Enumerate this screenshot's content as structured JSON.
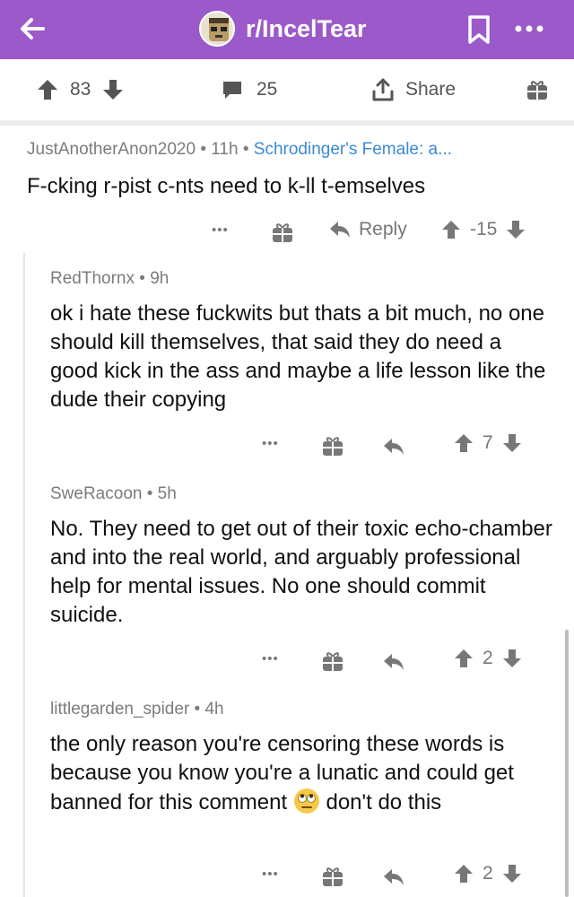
{
  "header": {
    "subreddit": "r/IncelTear",
    "back_icon": "arrow-left-icon",
    "bookmark_icon": "bookmark-icon",
    "more_icon": "more-horizontal-icon",
    "bar_color": "#9b59c9"
  },
  "post_actions": {
    "score": "83",
    "comments": "25",
    "share": "Share"
  },
  "comments": [
    {
      "author": "JustAnotherAnon2020",
      "age": "11h",
      "flair": "Schrodinger's Female: a...",
      "text": "F-cking r-pist c-nts need to k-ll t-emselves",
      "reply": "Reply",
      "score": "-15"
    },
    {
      "author": "RedThornx",
      "age": "9h",
      "text": "ok i hate these fuckwits but thats a bit much, no one should kill themselves, that said they do need a good kick in the ass and maybe a life lesson like the dude their copying",
      "score": "7"
    },
    {
      "author": "SweRacoon",
      "age": "5h",
      "text": "No. They need to get out of their toxic echo-chamber and into the real world, and arguably professional help for mental issues. No one should commit suicide.",
      "score": "2"
    },
    {
      "author": "littlegarden_spider",
      "age": "4h",
      "text": "the only reason you're censoring these words is because you know you're a lunatic and could get banned for this comment",
      "text_after_emoji": "don't do this",
      "emoji": "eye-roll-emoji",
      "score": "2"
    }
  ],
  "separator": "•",
  "more_dots": "•••"
}
